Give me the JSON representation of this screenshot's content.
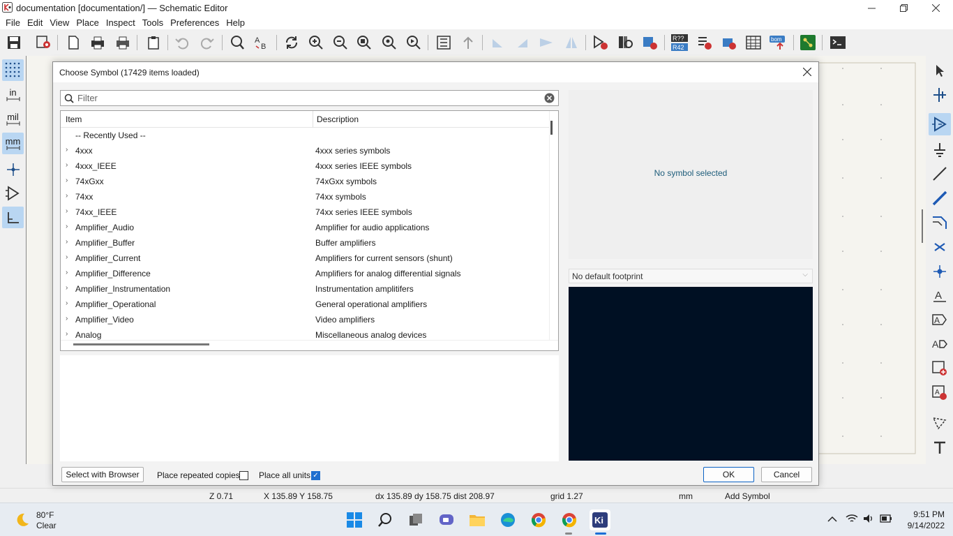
{
  "window": {
    "title": "documentation [documentation/] — Schematic Editor",
    "controls": [
      "minimize",
      "restore",
      "close"
    ]
  },
  "menu": [
    "File",
    "Edit",
    "View",
    "Place",
    "Inspect",
    "Tools",
    "Preferences",
    "Help"
  ],
  "left_toolbar": {
    "units": {
      "in": "in",
      "mil": "mil",
      "mm": "mm"
    }
  },
  "dialog": {
    "title": "Choose Symbol (17429 items loaded)",
    "filter_placeholder": "Filter",
    "columns": {
      "item": "Item",
      "description": "Description"
    },
    "recently_used": "-- Recently Used --",
    "rows": [
      {
        "name": "4xxx",
        "desc": "4xxx series symbols"
      },
      {
        "name": "4xxx_IEEE",
        "desc": "4xxx series IEEE symbols"
      },
      {
        "name": "74xGxx",
        "desc": "74xGxx symbols"
      },
      {
        "name": "74xx",
        "desc": "74xx symbols"
      },
      {
        "name": "74xx_IEEE",
        "desc": "74xx series IEEE symbols"
      },
      {
        "name": "Amplifier_Audio",
        "desc": "Amplifier for audio applications"
      },
      {
        "name": "Amplifier_Buffer",
        "desc": "Buffer amplifiers"
      },
      {
        "name": "Amplifier_Current",
        "desc": "Amplifiers for current sensors (shunt)"
      },
      {
        "name": "Amplifier_Difference",
        "desc": "Amplifiers for analog differential signals"
      },
      {
        "name": "Amplifier_Instrumentation",
        "desc": "Instrumentation amplitifers"
      },
      {
        "name": "Amplifier_Operational",
        "desc": "General operational amplifiers"
      },
      {
        "name": "Amplifier_Video",
        "desc": "Video amplifiers"
      },
      {
        "name": "Analog",
        "desc": "Miscellaneous analog devices"
      }
    ],
    "no_symbol": "No symbol selected",
    "footprint": "No default footprint",
    "select_browser": "Select with Browser",
    "place_repeated": "Place repeated copies",
    "place_repeated_checked": false,
    "place_all_units": "Place all units",
    "place_all_units_checked": true,
    "ok": "OK",
    "cancel": "Cancel"
  },
  "status": {
    "zoom": "Z 0.71",
    "xy": "X 135.89  Y 158.75",
    "delta": "dx 135.89  dy 158.75  dist 208.97",
    "grid": "grid 1.27",
    "units": "mm",
    "mode": "Add Symbol"
  },
  "taskbar": {
    "temp": "80°F",
    "weather": "Clear",
    "time": "9:51 PM",
    "date": "9/14/2022"
  }
}
